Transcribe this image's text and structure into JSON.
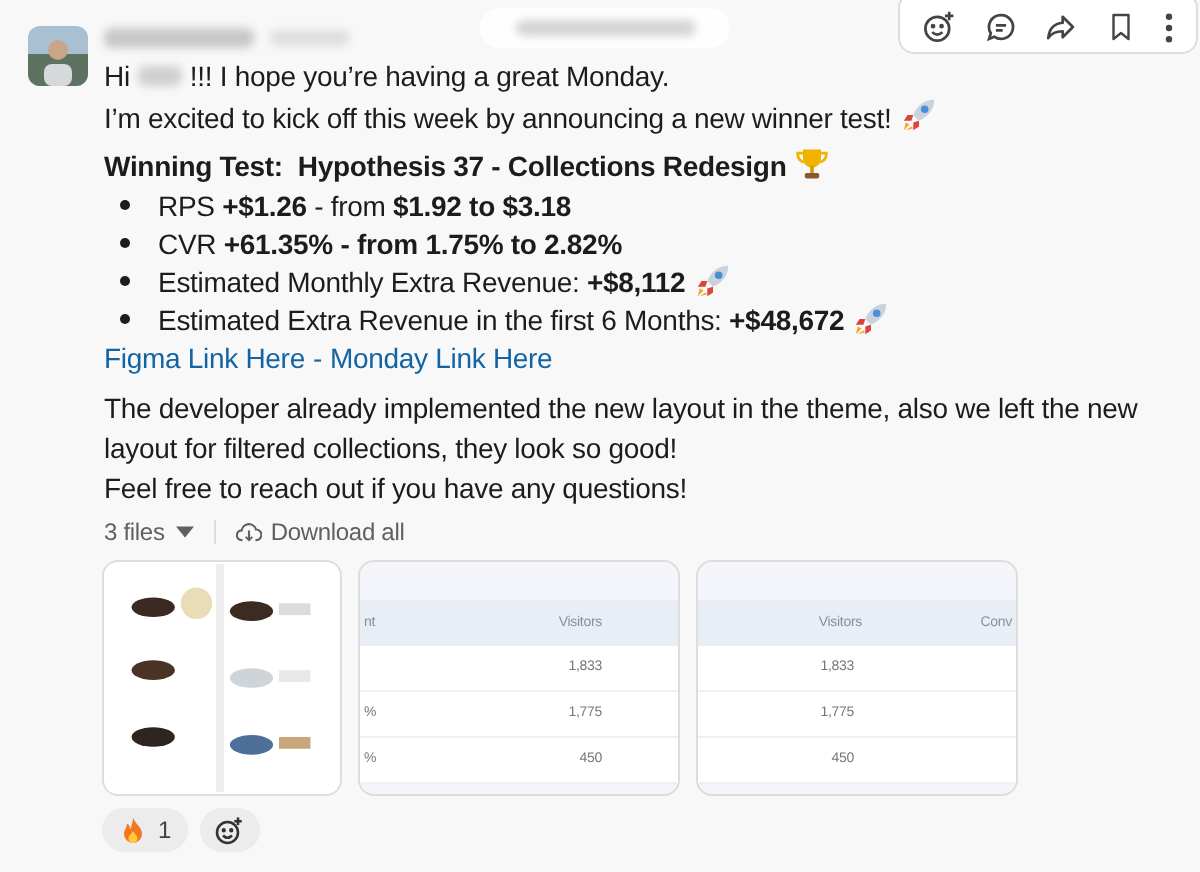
{
  "message": {
    "greeting": {
      "before": "Hi",
      "after": "!!! I hope you’re having a great Monday."
    },
    "intro": {
      "text": "I’m excited to kick off this week by announcing a new winner test!",
      "kind": "rocket"
    },
    "heading": {
      "text": "Winning Test:  Hypothesis 37 - Collections Redesign",
      "kind": "trophy"
    },
    "bullets": [
      {
        "text": "RPS **+$1.26** - from **$1.92 to $3.18**"
      },
      {
        "text": "CVR **+61.35% - from 1.75% to 2.82%**"
      },
      {
        "text": "Estimated Monthly Extra Revenue: **+$8,112**",
        "kind": "rocket"
      },
      {
        "text": "Estimated Extra Revenue in the first 6 Months: **+$48,672**",
        "kind": "rocket"
      }
    ],
    "links": [
      {
        "label": "Figma Link Here"
      },
      {
        "label": "Monday Link Here"
      }
    ],
    "link_separator": "-",
    "paragraphs": [
      "The developer already implemented the new layout in the theme, also we left the new layout for filtered collections, they look so good!",
      "Feel free to reach out if you have any questions!"
    ]
  },
  "files": {
    "count": "3 files",
    "download": "Download all",
    "attachments": [
      {
        "kind": "picture"
      },
      {
        "kind": "table",
        "header": [
          "nt",
          "Visitors"
        ],
        "rows": [
          [
            "",
            "1,833"
          ],
          [
            "%",
            "1,775"
          ],
          [
            "%",
            "450"
          ]
        ]
      },
      {
        "kind": "table",
        "header": [
          "Visitors",
          "Conv"
        ],
        "rows": [
          [
            "1,833",
            ""
          ],
          [
            "1,775",
            ""
          ],
          [
            "450",
            ""
          ]
        ]
      }
    ]
  },
  "reactions": [
    {
      "kind": "fire",
      "count": "1"
    }
  ]
}
